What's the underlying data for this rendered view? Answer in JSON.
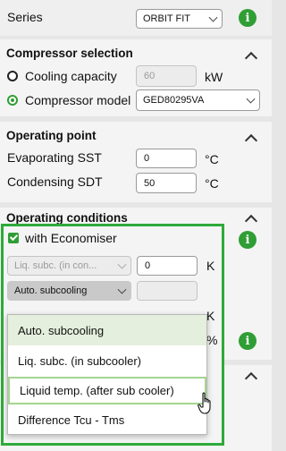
{
  "series": {
    "label": "Series",
    "value": "ORBIT FIT",
    "info_icon": "info-icon"
  },
  "compressor_selection": {
    "title": "Compressor selection",
    "options": [
      {
        "label": "Cooling capacity",
        "value": "60",
        "unit": "kW",
        "selected": false
      },
      {
        "label": "Compressor model",
        "value": "GED80295VA",
        "selected": true
      }
    ]
  },
  "operating_point": {
    "title": "Operating point",
    "fields": [
      {
        "label": "Evaporating SST",
        "value": "0",
        "unit": "°C"
      },
      {
        "label": "Condensing SDT",
        "value": "50",
        "unit": "°C"
      }
    ]
  },
  "operating_conditions": {
    "title": "Operating conditions",
    "economiser_label": "with Economiser",
    "economiser_checked": true,
    "row1_select": "Liq. subc. (in con...",
    "row1_value": "0",
    "row1_unit": "K",
    "row2_select": "Auto. subcooling",
    "row2_value": "",
    "row3_unit": "K",
    "row4_unit": "%"
  },
  "dropdown": {
    "options": [
      {
        "label": "Auto. subcooling",
        "state": "selected"
      },
      {
        "label": "Liq. subc. (in subcooler)",
        "state": "normal"
      },
      {
        "label": "Liquid temp. (after sub cooler)",
        "state": "hover"
      },
      {
        "label": "Difference Tcu - Tms",
        "state": "normal"
      }
    ]
  },
  "colors": {
    "accent": "#2f9e35",
    "highlight_border": "#2eaa3a",
    "selected_option_bg": "#e4efdd"
  }
}
